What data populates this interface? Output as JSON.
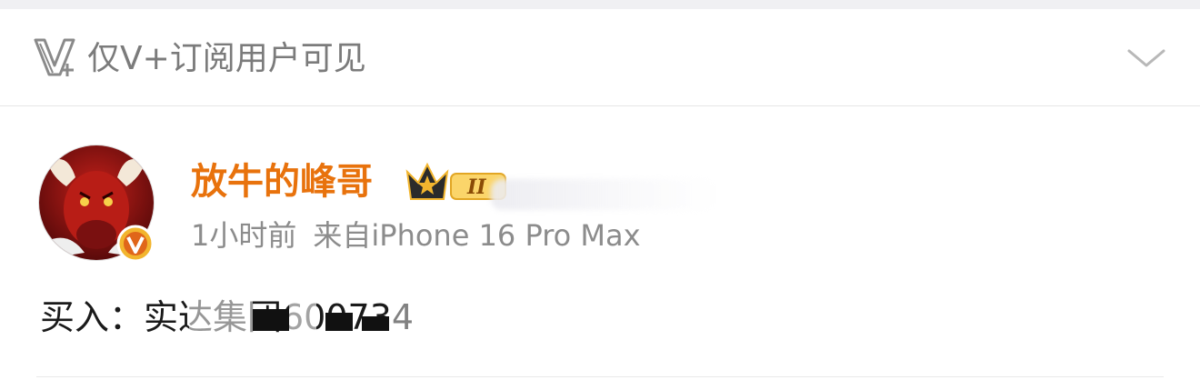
{
  "vip_bar": {
    "icon": "v-plus-icon",
    "text": "仅V+订阅用户可见",
    "chevron": "chevron-down-icon"
  },
  "post": {
    "author": {
      "name": "放牛的峰哥",
      "avatar": "bull-avatar",
      "verified_badge": "verified-v-icon",
      "badge_icon": "crown-icon",
      "badge_level": "II"
    },
    "time": "1小时前",
    "source": "来自iPhone 16 Pro Max",
    "content": "买入：实达集团600734"
  },
  "colors": {
    "username": "#e8720c",
    "meta": "#8c8c8c",
    "vip_text": "#7b7b7b",
    "badge_gold": "#f2b52e"
  }
}
